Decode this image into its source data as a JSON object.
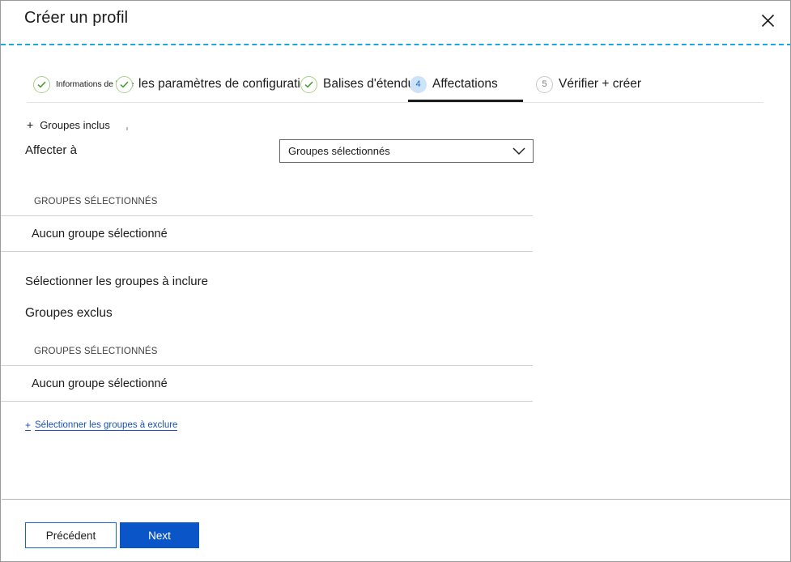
{
  "window": {
    "title": "Créer un profil",
    "close_icon": "close-icon"
  },
  "wizard": {
    "steps": [
      {
        "number": "1",
        "label": "Informations de base",
        "state": "done",
        "icon": "check-icon"
      },
      {
        "number": "2",
        "label": "les paramètres de configuration",
        "state": "done",
        "icon": "check-icon"
      },
      {
        "number": "3",
        "label": "Balises d'étendue",
        "state": "done",
        "icon": "check-icon"
      },
      {
        "number": "4",
        "label": "Affectations",
        "state": "current",
        "icon": ""
      },
      {
        "number": "5",
        "label": "Vérifier + créer",
        "state": "pending",
        "icon": ""
      }
    ]
  },
  "main": {
    "included_groups_heading": "Groupes inclus",
    "included_groups_plus": "+",
    "assign_to_label": "Affecter à",
    "assign_to_value": "Groupes sélectionnés",
    "assign_to_caret": "chevron-down-icon",
    "included_table": {
      "column_header": "GROUPES SÉLECTIONNÉS",
      "empty_text": "Aucun groupe sélectionné"
    },
    "select_include_link": "Sélectionner les groupes à inclure",
    "excluded_groups_heading": "Groupes exclus",
    "excluded_table": {
      "column_header": "GROUPES SÉLECTIONNÉS",
      "empty_text": "Aucun groupe sélectionné"
    },
    "select_exclude_plus": "+",
    "select_exclude_link": "Sélectionner les groupes à exclure"
  },
  "footer": {
    "previous_label": "Précédent",
    "next_label": "Next"
  },
  "colors": {
    "accent_blue": "#0a56c8",
    "link_blue": "#1a52b8",
    "dashed_rule": "#18a8e8",
    "step_done_green": "#4e9a35",
    "step_current_bg": "#cde3f7"
  }
}
